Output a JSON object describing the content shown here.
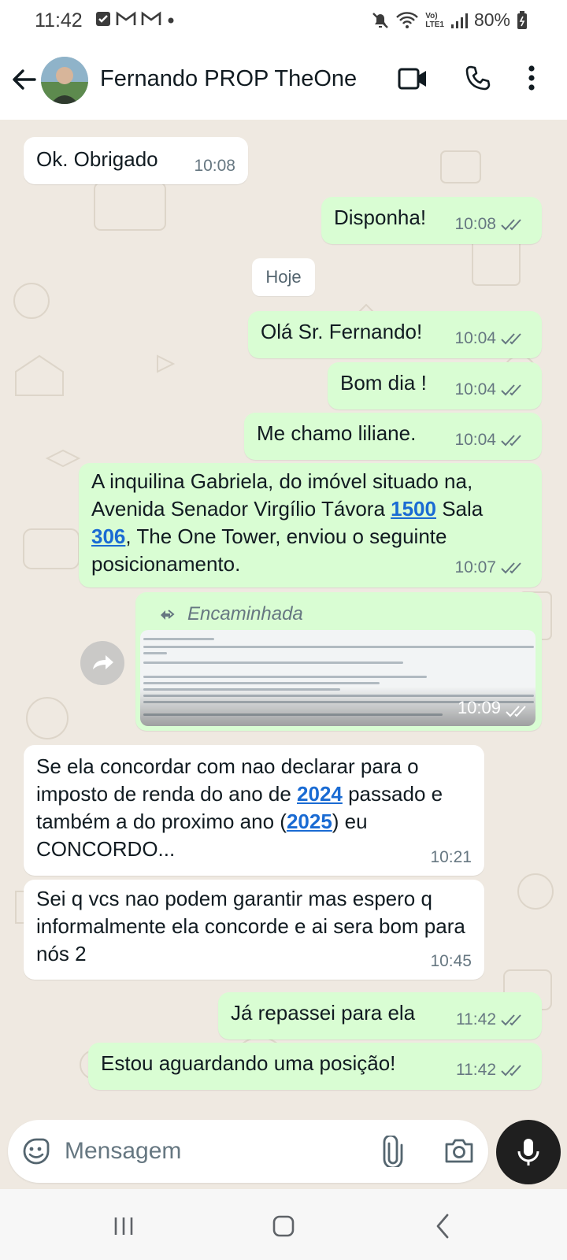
{
  "status_bar": {
    "time": "11:42",
    "notification_icons": [
      "checkbox-icon",
      "gmail-icon",
      "gmail-icon",
      "dot-icon"
    ],
    "network_label_top": "Vo)",
    "network_label_bottom": "LTE1",
    "battery": "80%"
  },
  "header": {
    "contact_name": "Fernando PROP TheOne",
    "icons": [
      "back-arrow-icon",
      "video-call-icon",
      "phone-icon",
      "more-vert-icon"
    ]
  },
  "chat": {
    "day_chip": "Hoje",
    "messages": [
      {
        "dir": "in",
        "text": "Ok. Obrigado",
        "time": "10:08"
      },
      {
        "dir": "out",
        "text": "Disponha!",
        "time": "10:08"
      },
      {
        "dir": "out",
        "text": "Olá Sr. Fernando!",
        "time": "10:04"
      },
      {
        "dir": "out",
        "text": "Bom dia !",
        "time": "10:04"
      },
      {
        "dir": "out",
        "text": "Me chamo liliane.",
        "time": "10:04"
      },
      {
        "dir": "out",
        "text_parts": {
          "a": "A inquilina  Gabriela, do imóvel situado na, Avenida Senador Virgílio Távora ",
          "link1": "1500",
          "b": " Sala ",
          "link2": "306",
          "c": ", The One Tower, enviou  o seguinte posicionamento."
        },
        "time": "10:07"
      },
      {
        "dir": "out",
        "forwarded_label": "Encaminhada",
        "type": "image",
        "time": "10:09"
      },
      {
        "dir": "in",
        "text_parts": {
          "a": "Se ela concordar com nao declarar para o imposto de renda do ano de ",
          "link1": "2024",
          "b": " passado e também a do proximo ano (",
          "link2": "2025",
          "c": ") eu  CONCORDO..."
        },
        "time": "10:21"
      },
      {
        "dir": "in",
        "text": "Sei q vcs nao podem garantir mas espero q informalmente ela concorde e ai sera bom para nós 2",
        "time": "10:45"
      },
      {
        "dir": "out",
        "text": "Já repassei para ela",
        "time": "11:42"
      },
      {
        "dir": "out",
        "text": "Estou aguardando uma posição!",
        "time": "11:42"
      }
    ]
  },
  "input_bar": {
    "placeholder": "Mensagem",
    "icons": [
      "emoji-icon",
      "attach-icon",
      "camera-icon",
      "mic-icon"
    ]
  },
  "colors": {
    "outgoing_bubble": "#d9fdd3",
    "incoming_bubble": "#ffffff",
    "chat_background": "#efe9e1",
    "link": "#1a6bd3",
    "read_ticks": "#667781"
  }
}
